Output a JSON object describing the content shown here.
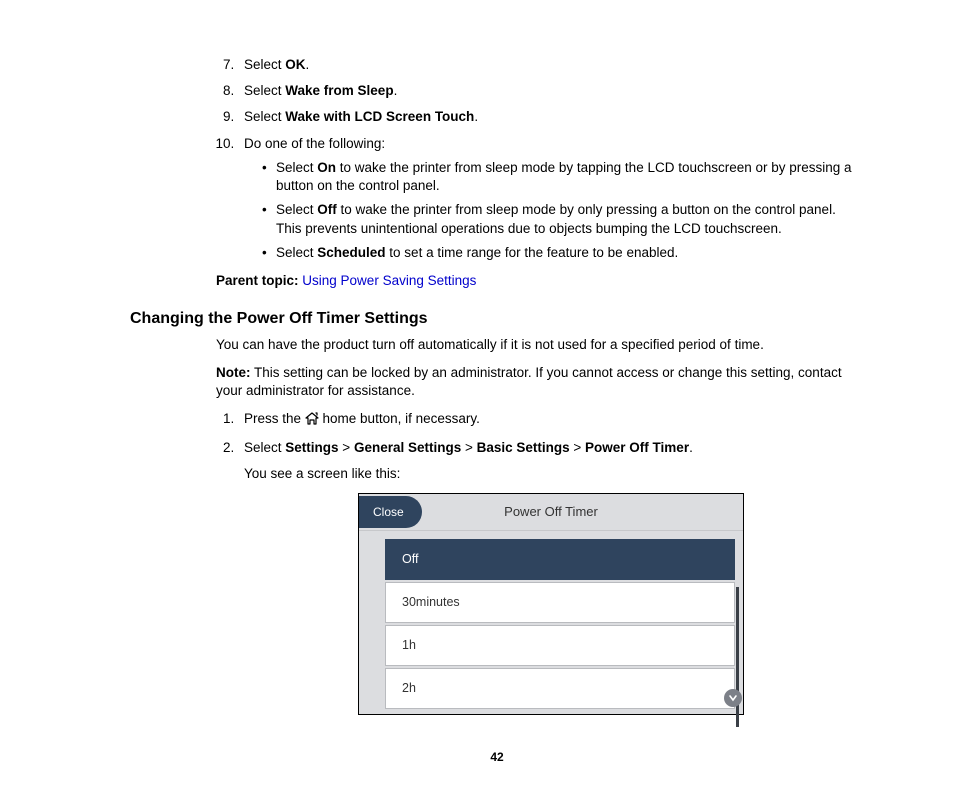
{
  "steps7_10": {
    "s7_pre": "Select ",
    "s7_bold": "OK",
    "s7_post": ".",
    "s8_pre": "Select ",
    "s8_bold": "Wake from Sleep",
    "s8_post": ".",
    "s9_pre": "Select ",
    "s9_bold": "Wake with LCD Screen Touch",
    "s9_post": ".",
    "s10": "Do one of the following:",
    "sub": {
      "a_pre": "Select ",
      "a_bold": "On",
      "a_post": " to wake the printer from sleep mode by tapping the LCD touchscreen or by pressing a button on the control panel.",
      "b_pre": "Select ",
      "b_bold": "Off",
      "b_post": " to wake the printer from sleep mode by only pressing a button on the control panel. This prevents unintentional operations due to objects bumping the LCD touchscreen.",
      "c_pre": "Select ",
      "c_bold": "Scheduled",
      "c_post": " to set a time range for the feature to be enabled."
    }
  },
  "parent_topic_label": "Parent topic:",
  "parent_topic_link": "Using Power Saving Settings",
  "heading": "Changing the Power Off Timer Settings",
  "intro": "You can have the product turn off automatically if it is not used for a specified period of time.",
  "note_label": "Note:",
  "note_body": " This setting can be locked by an administrator. If you cannot access or change this setting, contact your administrator for assistance.",
  "steps1_2": {
    "s1_pre": "Press the ",
    "s1_post": " home button, if necessary.",
    "s2_pre": "Select ",
    "s2_b1": "Settings",
    "s2_gt": " > ",
    "s2_b2": "General Settings",
    "s2_b3": "Basic Settings",
    "s2_b4": "Power Off Timer",
    "s2_post": ".",
    "s2_follow": "You see a screen like this:"
  },
  "screen": {
    "close": "Close",
    "title": "Power Off Timer",
    "options": [
      "Off",
      "30minutes",
      "1h",
      "2h"
    ],
    "selected_index": 0
  },
  "page_number": "42"
}
